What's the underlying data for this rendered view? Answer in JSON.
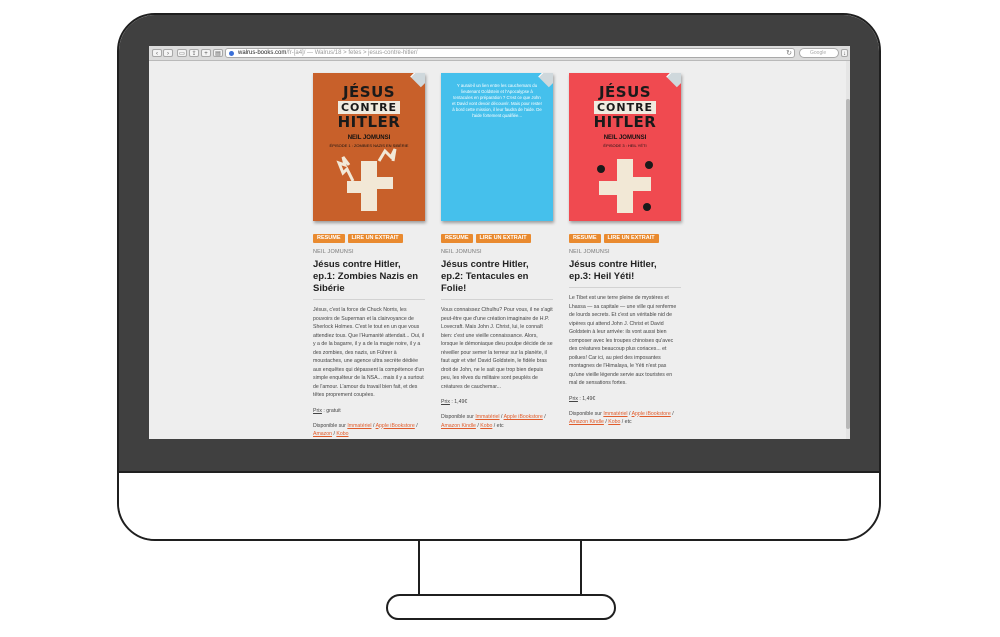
{
  "browser": {
    "url_domain": "walrus-books.com",
    "url_path": "/fr-[a4]/ — Walrus/18 > fetes > jesus-contre-hitler/",
    "reload_symbol": "↻",
    "search_placeholder": "Google"
  },
  "cover_text": {
    "line1": "JÉSUS",
    "line2": "CONTRE",
    "line3": "HITLER",
    "author": "NEIL JOMUNSI",
    "ep1": "ÉPISODE 1 : ZOMBIES NAZIS EN SIBÉRIE",
    "ep3": "ÉPISODE 3 : HEIL YÉTI",
    "teaser": "Y aurait-il un lien entre les cauchemars du lieutenant Goldstein et l'Apocalypse à tentacules en préparation ? C'est ce que John et David vont devoir découvrir. Mais pour rester à bord cette mission, il leur faudra de l'aide. De l'aide fortement qualifiée..."
  },
  "books": [
    {
      "tag_summary": "RESUME",
      "tag_excerpt": "LIRE UN EXTRAIT",
      "author": "NEIL JOMUNSI",
      "title": "Jésus contre Hitler, ep.1: Zombies Nazis en Sibérie",
      "description": "Jésus, c'est la force de Chuck Norris, les pouvoirs de Superman et la clairvoyance de Sherlock Holmes. C'est le tout en un que vous attendiez tous. Que l'Humanité attendait... Oui, il y a de la bagarre, il y a de la magie noire, il y a des zombies, des nazis, un Führer à moustaches, une agence ultra secrète dédiée aux enquêtes qui dépassent la compétence d'un simple enquêteur de la NSA... mais il y a surtout de l'amour. L'amour du travail bien fait, et des têtes proprement coupées.",
      "price_label": "Prix",
      "price_value": " : gratuit",
      "avail_label": "Disponible sur ",
      "stores": [
        "Immatériel",
        "Apple iBookstore",
        "Amazon",
        "Kobo"
      ],
      "avail_tail": ""
    },
    {
      "tag_summary": "RESUME",
      "tag_excerpt": "LIRE UN EXTRAIT",
      "author": "NEIL JOMUNSI",
      "title": "Jésus contre Hitler, ep.2: Tentacules en Folie!",
      "description": "Vous connaissez Cthulhu? Pour vous, il ne s'agit peut-être que d'une création imaginaire de H.P. Lovecraft. Mais John J. Christ, lui, le connaît bien: c'est une vieille connaissance. Alors, lorsque le démoniaque dieu poulpe décide de se réveiller pour semer la terreur sur la planète, il faut agir et vite! David Goldstein, le fidèle bras droit de John, ne le sait que trop bien depuis peu, les rêves du militaire sont peuplés de créatures de cauchemar...",
      "price_label": "Prix",
      "price_value": " : 1,49€",
      "avail_label": "Disponible sur ",
      "stores": [
        "Immatériel",
        "Apple iBookstore",
        "Amazon Kindle",
        "Kobo"
      ],
      "avail_tail": " / etc"
    },
    {
      "tag_summary": "RESUME",
      "tag_excerpt": "LIRE UN EXTRAIT",
      "author": "NEIL JOMUNSI",
      "title": "Jésus contre Hitler, ep.3: Heil Yéti!",
      "description": "Le Tibet est une terre pleine de mystères et Lhassa — sa capitale — une ville qui renferme de lourds secrets. Et c'est un véritable nid de vipères qui attend John J. Christ et David Goldstein à leur arrivée: ils vont aussi bien composer avec les troupes chinoises qu'avec des créatures beaucoup plus coriaces... et poilues! Car ici, au pied des imposantes montagnes de l'Himalaya, le Yéti n'est pas qu'une vieille légende servie aux touristes en mal de sensations fortes.",
      "price_label": "Prix",
      "price_value": " : 1,49€",
      "avail_label": "Disponible sur ",
      "stores": [
        "Immatériel",
        "Apple iBookstore",
        "Amazon Kindle",
        "Kobo"
      ],
      "avail_tail": " / etc"
    }
  ],
  "colors": {
    "cover1": "#c8602a",
    "cover2": "#45c0ec",
    "cover3": "#f04a50",
    "tag": "#e98a2f",
    "link": "#e15c2b",
    "bezel": "#404040"
  }
}
